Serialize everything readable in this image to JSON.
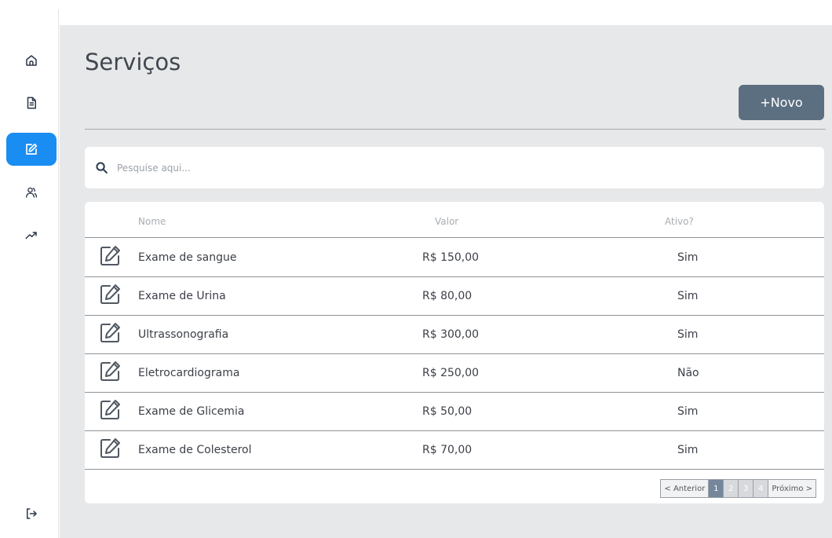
{
  "sidebar": {
    "items": [
      {
        "name": "home",
        "icon": "home-icon"
      },
      {
        "name": "documents",
        "icon": "document-icon"
      },
      {
        "name": "services",
        "icon": "edit-icon",
        "active": true
      },
      {
        "name": "users",
        "icon": "users-icon"
      },
      {
        "name": "reports",
        "icon": "trending-up-icon"
      }
    ],
    "logout_icon": "logout-icon",
    "accent_color": "#1a8df2"
  },
  "page": {
    "title": "Serviços",
    "new_button_label": "+Novo"
  },
  "search": {
    "placeholder": "Pesquise aqui..."
  },
  "table": {
    "headers": {
      "name": "Nome",
      "value": "Valor",
      "active": "Ativo?"
    },
    "rows": [
      {
        "name": "Exame de sangue",
        "value": "R$ 150,00",
        "active": "Sim"
      },
      {
        "name": "Exame de Urina",
        "value": "R$ 80,00",
        "active": "Sim"
      },
      {
        "name": "Ultrassonografia",
        "value": "R$ 300,00",
        "active": "Sim"
      },
      {
        "name": "Eletrocardiograma",
        "value": "R$ 250,00",
        "active": "Não"
      },
      {
        "name": "Exame de Glicemia",
        "value": "R$ 50,00",
        "active": "Sim"
      },
      {
        "name": "Exame de Colesterol",
        "value": "R$ 70,00",
        "active": "Sim"
      }
    ]
  },
  "pagination": {
    "prev": "< Anterior",
    "pages": [
      "1",
      "2",
      "3",
      "4"
    ],
    "current": "1",
    "next": "Próximo >"
  }
}
